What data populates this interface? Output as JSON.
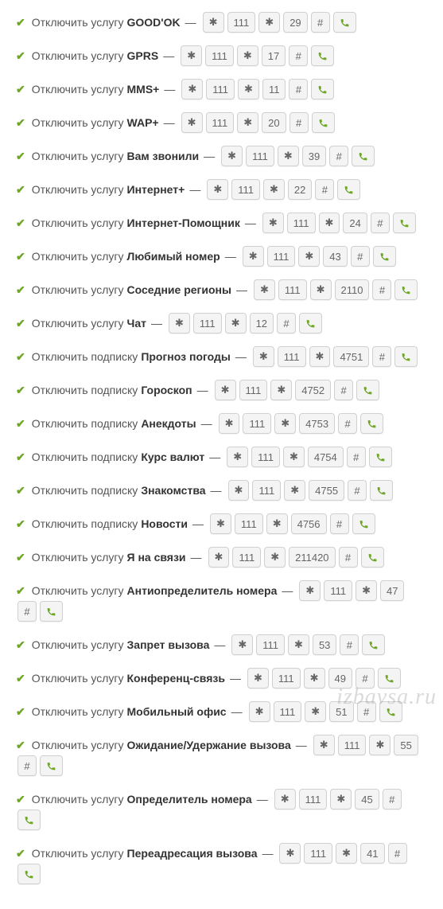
{
  "watermark": "izbavsa.ru",
  "star": "✱",
  "hash": "#",
  "rows": [
    {
      "prefix": "Отключить услугу",
      "name": "GOOD'OK",
      "codeA": "111",
      "codeB": "29"
    },
    {
      "prefix": "Отключить услугу",
      "name": "GPRS",
      "codeA": "111",
      "codeB": "17"
    },
    {
      "prefix": "Отключить услугу",
      "name": "MMS+",
      "codeA": "111",
      "codeB": "11"
    },
    {
      "prefix": "Отключить услугу",
      "name": "WAP+",
      "codeA": "111",
      "codeB": "20"
    },
    {
      "prefix": "Отключить услугу",
      "name": "Вам звонили",
      "codeA": "111",
      "codeB": "39"
    },
    {
      "prefix": "Отключить услугу",
      "name": "Интернет+",
      "codeA": "111",
      "codeB": "22"
    },
    {
      "prefix": "Отключить услугу",
      "name": "Интернет-Помощник",
      "codeA": "111",
      "codeB": "24"
    },
    {
      "prefix": "Отключить услугу",
      "name": "Любимый номер",
      "codeA": "111",
      "codeB": "43"
    },
    {
      "prefix": "Отключить услугу",
      "name": "Соседние регионы",
      "codeA": "111",
      "codeB": "2110"
    },
    {
      "prefix": "Отключить услугу",
      "name": "Чат",
      "codeA": "111",
      "codeB": "12"
    },
    {
      "prefix": "Отключить подписку",
      "name": "Прогноз погоды",
      "codeA": "111",
      "codeB": "4751"
    },
    {
      "prefix": "Отключить подписку",
      "name": "Гороскоп",
      "codeA": "111",
      "codeB": "4752"
    },
    {
      "prefix": "Отключить подписку",
      "name": "Анекдоты",
      "codeA": "111",
      "codeB": "4753"
    },
    {
      "prefix": "Отключить подписку",
      "name": "Курс валют",
      "codeA": "111",
      "codeB": "4754"
    },
    {
      "prefix": "Отключить подписку",
      "name": "Знакомства",
      "codeA": "111",
      "codeB": "4755"
    },
    {
      "prefix": "Отключить подписку",
      "name": "Новости",
      "codeA": "111",
      "codeB": "4756"
    },
    {
      "prefix": "Отключить услугу",
      "name": "Я на связи",
      "codeA": "111",
      "codeB": "211420"
    },
    {
      "prefix": "Отключить услугу",
      "name": "Антиопределитель номера",
      "codeA": "111",
      "codeB": "47"
    },
    {
      "prefix": "Отключить услугу",
      "name": "Запрет вызова",
      "codeA": "111",
      "codeB": "53"
    },
    {
      "prefix": "Отключить услугу",
      "name": "Конференц-связь",
      "codeA": "111",
      "codeB": "49"
    },
    {
      "prefix": "Отключить услугу",
      "name": "Мобильный офис",
      "codeA": "111",
      "codeB": "51"
    },
    {
      "prefix": "Отключить услугу",
      "name": "Ожидание/Удержание вызова",
      "codeA": "111",
      "codeB": "55"
    },
    {
      "prefix": "Отключить услугу",
      "name": "Определитель номера",
      "codeA": "111",
      "codeB": "45"
    },
    {
      "prefix": "Отключить услугу",
      "name": "Переадресация вызова",
      "codeA": "111",
      "codeB": "41"
    }
  ]
}
